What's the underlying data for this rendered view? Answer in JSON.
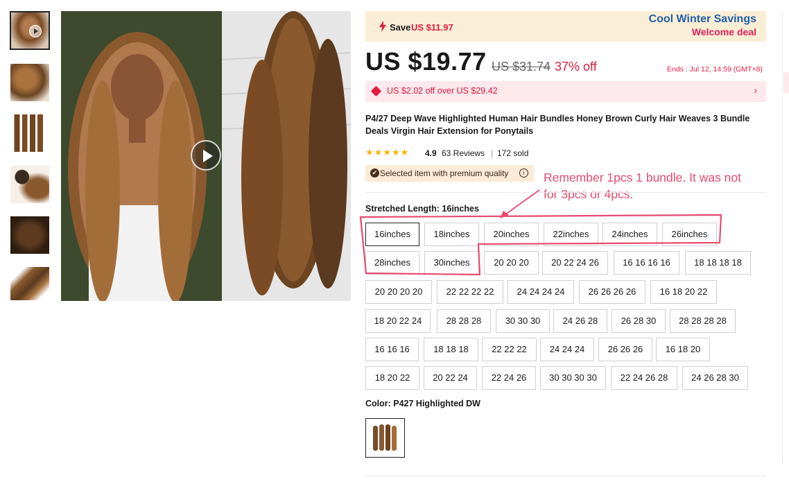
{
  "banner": {
    "save_label": "Save",
    "save_amount": "US $11.97",
    "promo_title": "Cool Winter Savings",
    "promo_subtitle": "Welcome deal"
  },
  "price": {
    "current": "US $19.77",
    "original": "US $31.74",
    "discount": "37% off",
    "ends": "Ends :  Jul 12, 14:59 (GMT+8)"
  },
  "coupon": {
    "text": "US $2.02 off over US $29.42",
    "arrow": "›"
  },
  "product": {
    "title": "P4/27 Deep Wave Highlighted Human Hair Bundles Honey Brown Curly Hair Weaves 3 Bundle Deals Virgin Hair Extension for Ponytails"
  },
  "ratings": {
    "stars": "★★★★★",
    "score": "4.9",
    "reviews": "63 Reviews",
    "separator": "|",
    "sold": "172 sold"
  },
  "quality_badge": {
    "text": "Selected item with premium quality",
    "icon": "✔",
    "info": "i"
  },
  "annotation": {
    "text": "Remember 1pcs 1 bundle. It was not for 3pcs or 4pcs."
  },
  "length": {
    "label": "Stretched Length: 16inches",
    "options": [
      "16inches",
      "18inches",
      "20inches",
      "22inches",
      "24inches",
      "26inches",
      "28inches",
      "30inches",
      "20 20 20",
      "20 22 24 26",
      "16 16 16 16",
      "18 18 18 18",
      "20 20 20 20",
      "22 22 22 22",
      "24 24 24 24",
      "26 26 26 26",
      "16 18 20 22",
      "18 20 22 24",
      "28 28 28",
      "30 30 30",
      "24 26 28",
      "26 28 30",
      "28 28 28 28",
      "16 16 16",
      "18 18 18",
      "22 22 22",
      "24 24 24",
      "26 26 26",
      "16 18 20",
      "18 20 22",
      "20 22 24",
      "22 24 26",
      "30 30 30 30",
      "22 24 26 28",
      "24 26 28 30"
    ],
    "selected": "16inches"
  },
  "color": {
    "label": "Color: P427 Highlighted DW"
  },
  "colors": {
    "price_red": "#e31c3d",
    "promo_blue": "#1f5fa8",
    "annotation_pink": "#e84a6f",
    "star_gold": "#f7b500"
  }
}
